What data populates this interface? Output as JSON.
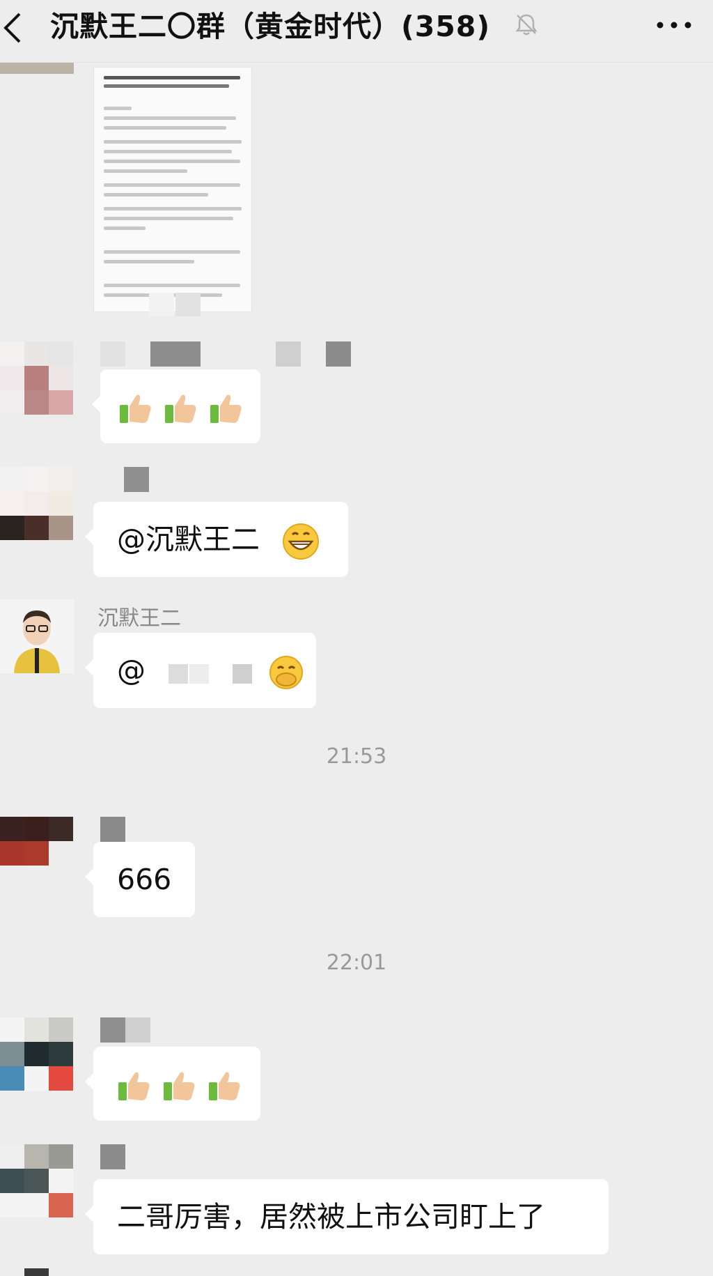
{
  "header": {
    "title": "沉默王二〇群（黄金时代）(358)",
    "back_icon": "chevron-left-icon",
    "mute_icon": "bell-off-icon",
    "more_icon": "ellipsis-icon"
  },
  "messages": [
    {
      "type": "image",
      "content": "document-screenshot"
    },
    {
      "type": "emoji",
      "emojis": [
        "thumbs-up",
        "thumbs-up",
        "thumbs-up"
      ]
    },
    {
      "type": "text",
      "text": "@沉默王二",
      "emoji": "grinning-face"
    },
    {
      "type": "text",
      "sender": "沉默王二",
      "text": "@",
      "emoji": "face-with-hand-over-mouth"
    },
    {
      "type": "time",
      "text": "21:53"
    },
    {
      "type": "text",
      "text": "666"
    },
    {
      "type": "time",
      "text": "22:01"
    },
    {
      "type": "emoji",
      "emojis": [
        "thumbs-up",
        "thumbs-up",
        "thumbs-up"
      ]
    },
    {
      "type": "text",
      "text": "二哥厉害，居然被上市公司盯上了"
    }
  ],
  "colors": {
    "background": "#ededed",
    "bubble": "#ffffff",
    "meta_text": "#888888"
  }
}
